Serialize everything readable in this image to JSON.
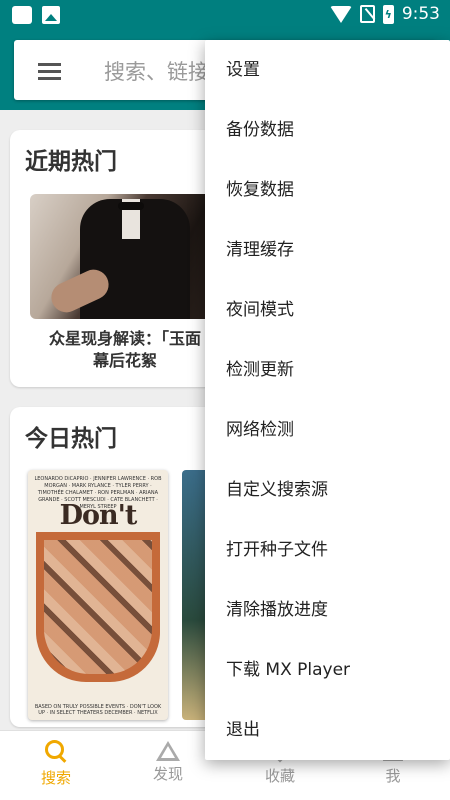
{
  "status_bar": {
    "time": "9:53",
    "battery_glyph": "ϟ"
  },
  "search": {
    "placeholder": "搜索、链接"
  },
  "sections": [
    {
      "title": "近期热门",
      "item_caption": "众星现身解读：「玉面\n幕后花絮"
    },
    {
      "title": "今日热门"
    }
  ],
  "poster": {
    "cast_line": "LEONARDO DiCAPRIO · JENNIFER LAWRENCE · ROB MORGAN · MARK RYLANCE · TYLER PERRY · TIMOTHÉE CHALAMET · RON PERLMAN · ARIANA GRANDE · SCOTT MESCUDI · CATE BLANCHETT · MERYL STREEP",
    "title": "Don't Look",
    "bottom_line": "BASED ON TRULY POSSIBLE EVENTS · DON'T LOOK UP · IN SELECT THEATERS DECEMBER · NETFLIX"
  },
  "bottom_nav": [
    {
      "label": "搜索",
      "icon": "search-icon",
      "active": true
    },
    {
      "label": "发现",
      "icon": "triangle-icon",
      "active": false
    },
    {
      "label": "收藏",
      "icon": "diamond-icon",
      "active": false
    },
    {
      "label": "我",
      "icon": "person-icon",
      "active": false
    }
  ],
  "menu": {
    "items": [
      "设置",
      "备份数据",
      "恢复数据",
      "清理缓存",
      "夜间模式",
      "检测更新",
      "网络检测",
      "自定义搜索源",
      "打开种子文件",
      "清除播放进度",
      "下载 MX Player",
      "退出"
    ]
  },
  "colors": {
    "primary": "#008080",
    "accent": "#f0a800"
  }
}
